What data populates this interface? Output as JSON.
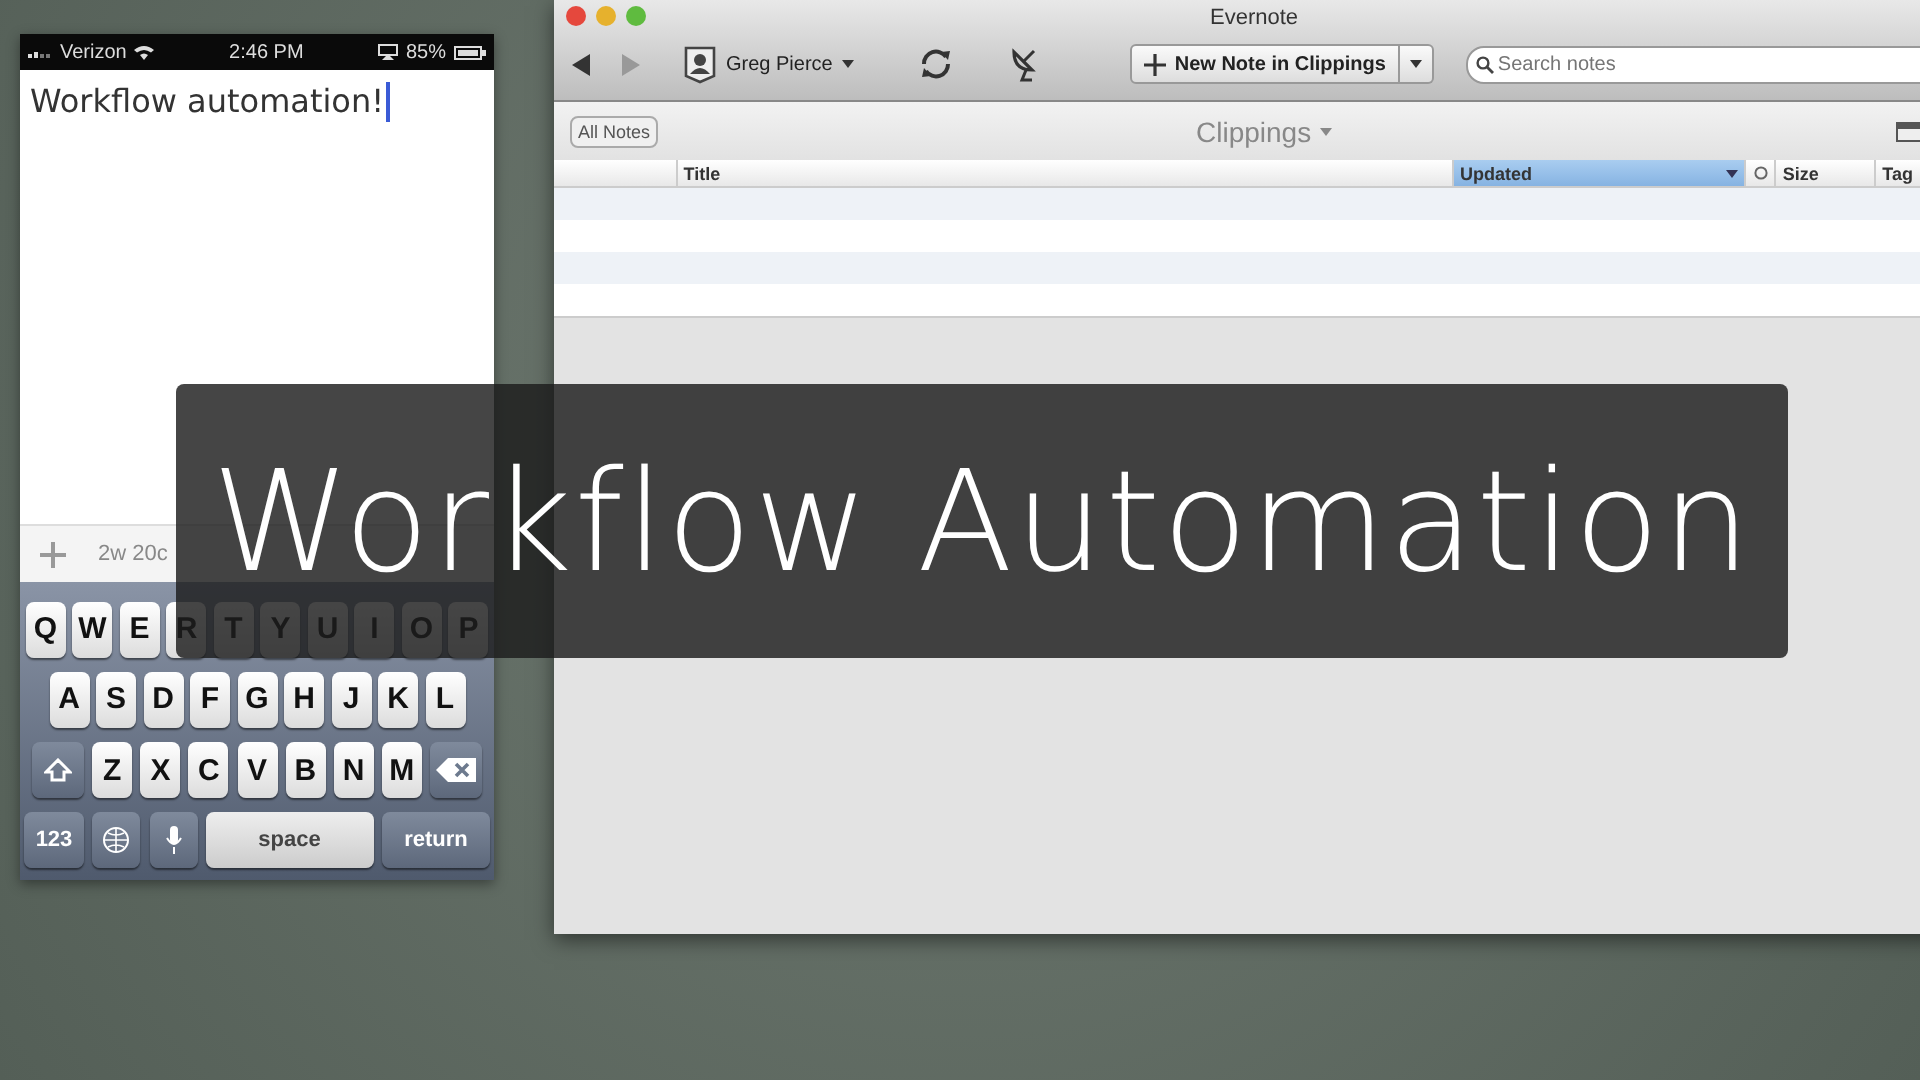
{
  "phone": {
    "status_bar": {
      "carrier": "Verizon",
      "time": "2:46 PM",
      "battery": "85%"
    },
    "note_text": "Workflow automation!",
    "toolbar": {
      "count": "2w 20c"
    },
    "keyboard": [
      [
        {
          "kind": "letter",
          "label": "Q"
        },
        {
          "kind": "letter",
          "label": "W"
        },
        {
          "kind": "letter",
          "label": "E"
        },
        {
          "kind": "letter",
          "label": "R"
        },
        {
          "kind": "letter",
          "label": "T"
        },
        {
          "kind": "letter",
          "label": "Y"
        },
        {
          "kind": "letter",
          "label": "U"
        },
        {
          "kind": "letter",
          "label": "I"
        },
        {
          "kind": "letter",
          "label": "O"
        },
        {
          "kind": "letter",
          "label": "P"
        }
      ],
      [
        {
          "kind": "letter",
          "label": "A"
        },
        {
          "kind": "letter",
          "label": "S"
        },
        {
          "kind": "letter",
          "label": "D"
        },
        {
          "kind": "letter",
          "label": "F"
        },
        {
          "kind": "letter",
          "label": "G"
        },
        {
          "kind": "letter",
          "label": "H"
        },
        {
          "kind": "letter",
          "label": "J"
        },
        {
          "kind": "letter",
          "label": "K"
        },
        {
          "kind": "letter",
          "label": "L"
        }
      ],
      [
        {
          "kind": "shift"
        },
        {
          "kind": "letter",
          "label": "Z"
        },
        {
          "kind": "letter",
          "label": "X"
        },
        {
          "kind": "letter",
          "label": "C"
        },
        {
          "kind": "letter",
          "label": "V"
        },
        {
          "kind": "letter",
          "label": "B"
        },
        {
          "kind": "letter",
          "label": "N"
        },
        {
          "kind": "letter",
          "label": "M"
        },
        {
          "kind": "backspace"
        }
      ],
      [
        {
          "kind": "function",
          "label": "123"
        },
        {
          "kind": "globe"
        },
        {
          "kind": "mic"
        },
        {
          "kind": "space",
          "label": "space"
        },
        {
          "kind": "function",
          "label": "return"
        }
      ]
    ]
  },
  "mac_window": {
    "title": "Evernote",
    "account": "Greg Pierce",
    "new_note_button": "New Note in Clippings",
    "search": {
      "placeholder": "Search notes"
    },
    "all_notes_button": "All Notes",
    "notebook": "Clippings",
    "columns": [
      {
        "label": "Title",
        "selected": false
      },
      {
        "label": "Updated",
        "selected": true
      },
      {
        "label": "Size",
        "selected": false
      },
      {
        "label": "Tag",
        "selected": false
      }
    ]
  },
  "overlay_title": "Workflow Automation"
}
